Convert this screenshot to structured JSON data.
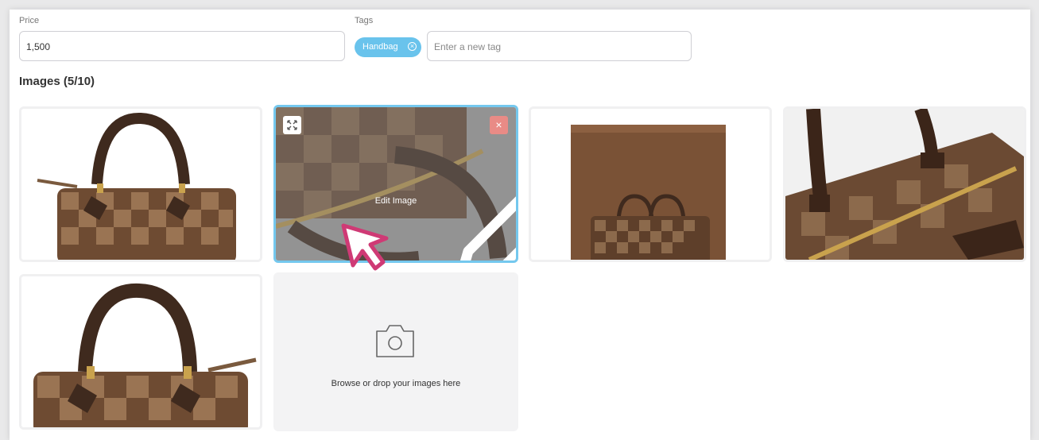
{
  "form": {
    "price_label": "Price",
    "price_value": "1,500",
    "tags_label": "Tags",
    "tag_chips": [
      "Handbag"
    ],
    "tag_remove_glyph": "×",
    "tag_input_placeholder": "Enter a new tag"
  },
  "images": {
    "heading": "Images (5/10)",
    "items": [
      {
        "name": "bag-front",
        "selected": false
      },
      {
        "name": "bag-detail-zipper",
        "selected": true
      },
      {
        "name": "bag-with-box",
        "selected": false
      },
      {
        "name": "bag-top-closeup",
        "selected": false
      },
      {
        "name": "bag-front-closeup",
        "selected": false
      }
    ],
    "edit_label": "Edit Image",
    "remove_glyph": "×",
    "dropzone_text": "Browse or drop your images here"
  },
  "icons": [
    "expand-icon",
    "close-icon",
    "pencil-icon",
    "camera-icon",
    "cursor-hand-icon",
    "remove-tag-icon"
  ],
  "colors": {
    "accent": "#69c3ec",
    "selected_border": "#74c8ee",
    "remove_button": "#e98b86",
    "bag_dark": "#5a3a26",
    "bag_light": "#8b6445",
    "cursor_pink": "#cf3a75"
  }
}
